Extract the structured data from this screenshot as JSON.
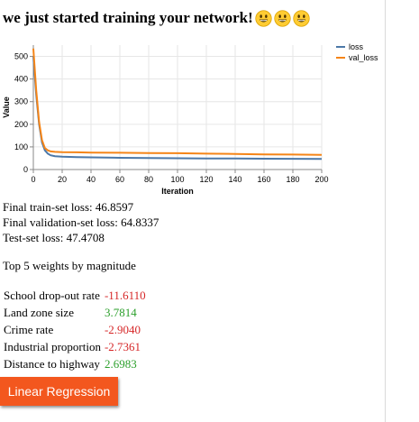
{
  "headline": "we just started training your network!",
  "colors": {
    "loss": "#4c78a8",
    "val_loss": "#f58518",
    "negative": "#d62728",
    "positive": "#2ca02c",
    "button": "#f3571e"
  },
  "chart_data": {
    "type": "line",
    "xlabel": "Iteration",
    "ylabel": "Value",
    "xlim": [
      0,
      200
    ],
    "ylim": [
      0,
      550
    ],
    "xticks": [
      0,
      20,
      40,
      60,
      80,
      100,
      120,
      140,
      160,
      180,
      200
    ],
    "yticks": [
      0,
      100,
      200,
      300,
      400,
      500
    ],
    "grid": true,
    "legend_position": "top-right",
    "series": [
      {
        "name": "loss",
        "color": "#4c78a8",
        "x": [
          0,
          2,
          4,
          6,
          8,
          10,
          12,
          15,
          20,
          30,
          40,
          60,
          80,
          100,
          120,
          140,
          160,
          180,
          200
        ],
        "y": [
          500,
          330,
          200,
          120,
          85,
          70,
          63,
          59,
          57,
          55,
          54,
          52,
          51,
          50,
          49,
          48.5,
          48,
          47.5,
          47
        ]
      },
      {
        "name": "val_loss",
        "color": "#f58518",
        "x": [
          0,
          2,
          4,
          6,
          8,
          10,
          12,
          15,
          20,
          30,
          40,
          60,
          80,
          100,
          120,
          140,
          160,
          180,
          200
        ],
        "y": [
          535,
          350,
          210,
          130,
          95,
          85,
          80,
          78,
          77,
          76,
          75,
          74,
          73,
          72,
          70,
          69,
          67,
          66,
          65
        ]
      }
    ]
  },
  "stats": {
    "train": "Final train-set loss: 46.8597",
    "val": "Final validation-set loss: 64.8337",
    "test": "Test-set loss: 47.4708"
  },
  "weights_heading": "Top 5 weights by magnitude",
  "weights": [
    {
      "name": "School drop-out rate",
      "value": "-11.6110"
    },
    {
      "name": "Land zone size",
      "value": "3.7814"
    },
    {
      "name": "Crime rate",
      "value": "-2.9040"
    },
    {
      "name": "Industrial proportion",
      "value": "-2.7361"
    },
    {
      "name": "Distance to highway",
      "value": "2.6983"
    }
  ],
  "button_label": "Linear Regression"
}
